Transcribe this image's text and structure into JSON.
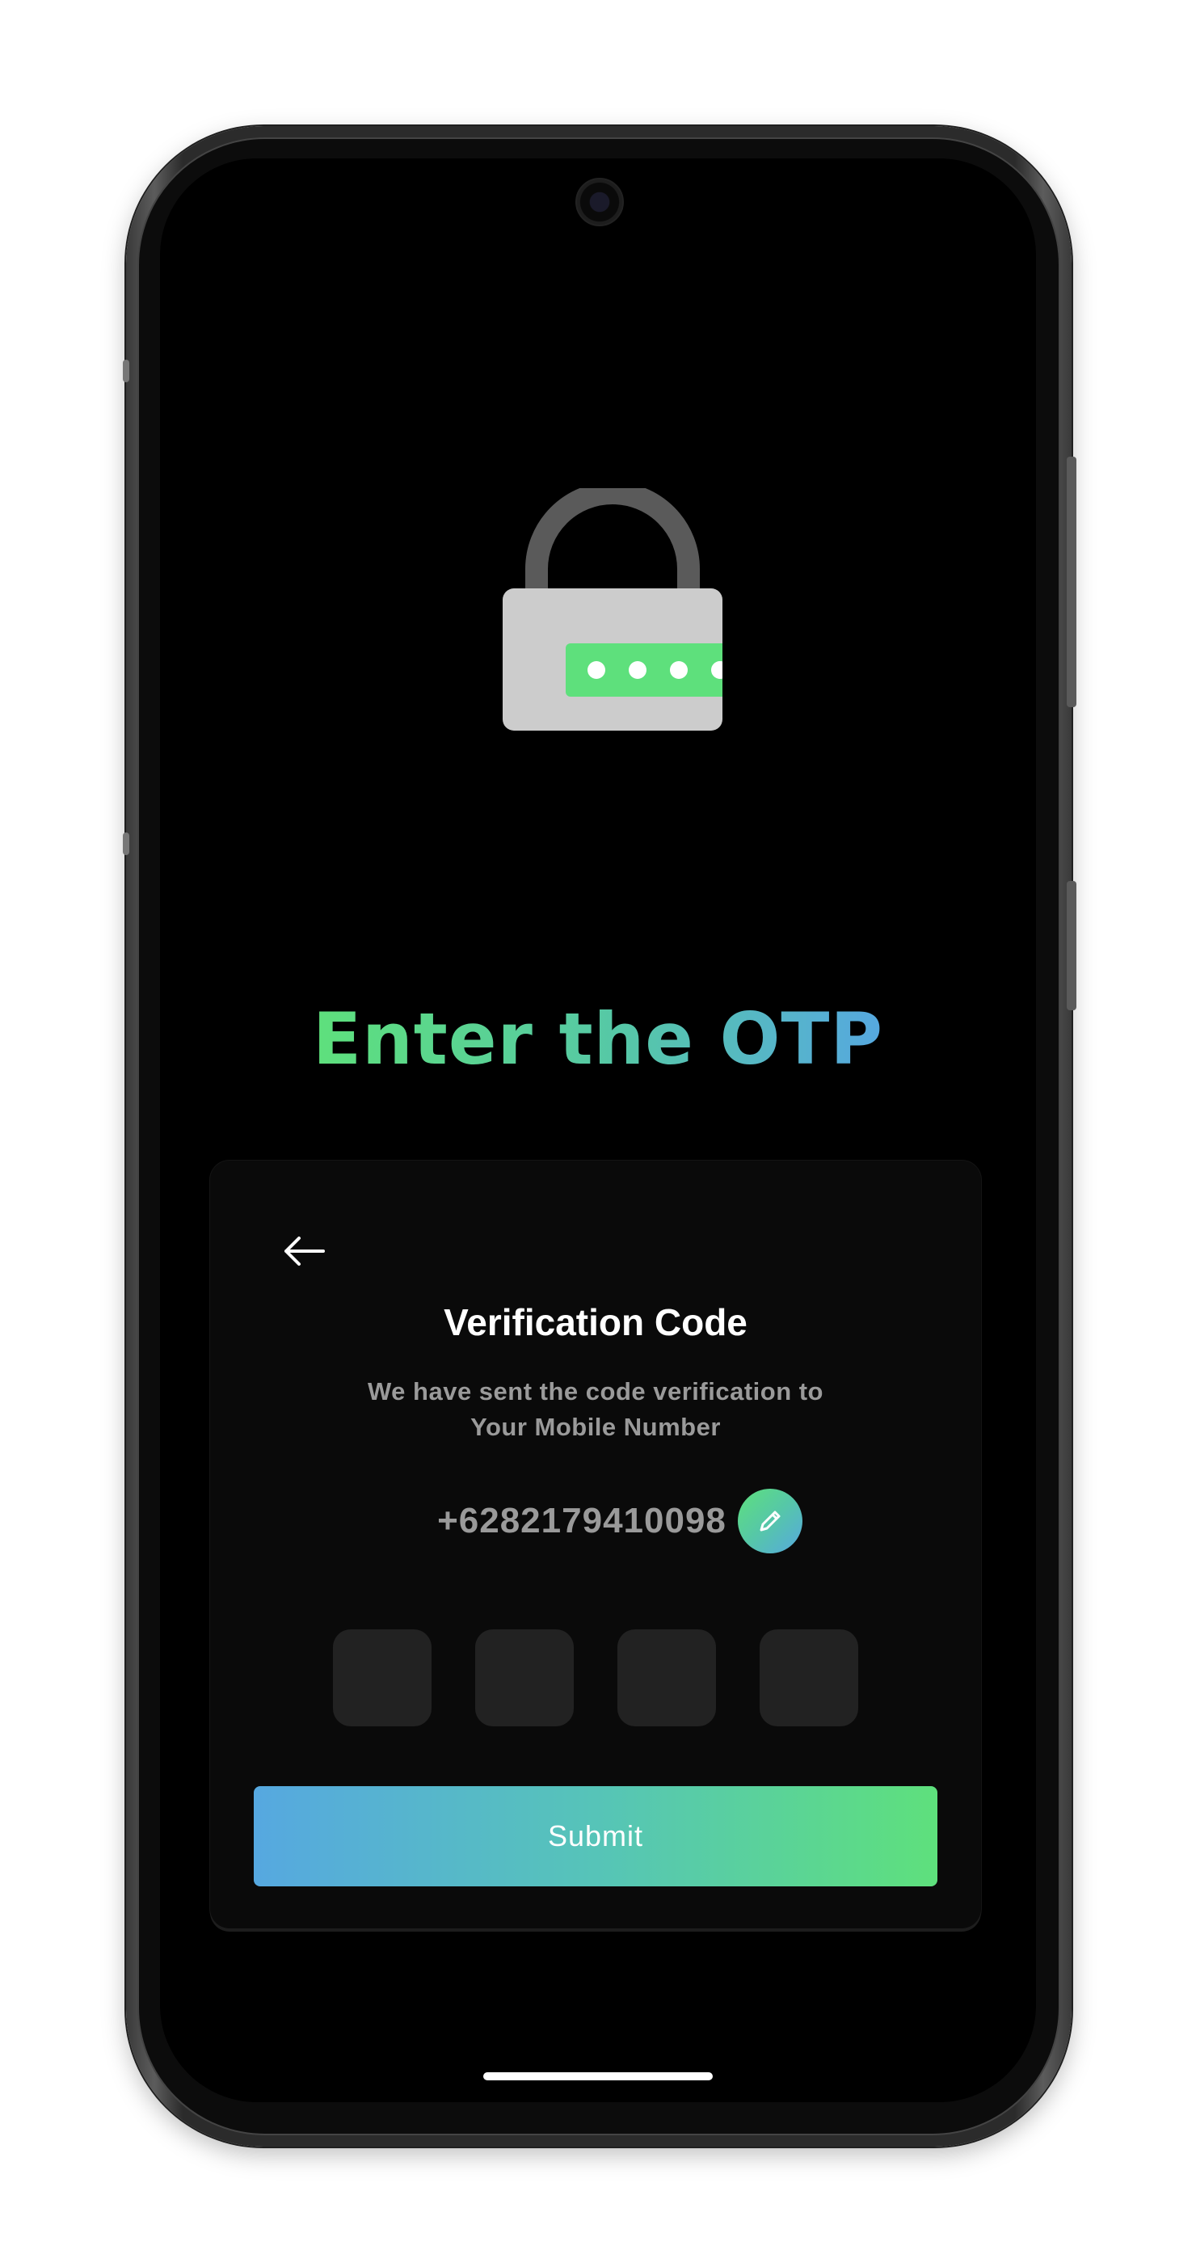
{
  "headline": {
    "text": "Enter the OTP"
  },
  "lock_illustration": {
    "icon": "padlock-password-icon",
    "password_dots": 4,
    "colors": {
      "shackle": "#5a5a5a",
      "body": "#cccccc",
      "field": "#5ee07c"
    }
  },
  "card": {
    "back_icon": "arrow-left-icon",
    "title": "Verification Code",
    "subtitle_line1": "We have sent the code verification to",
    "subtitle_line2": "Your Mobile Number",
    "phone_number": "+6282179410098",
    "edit_icon": "pencil-icon",
    "otp_digits": [
      "",
      "",
      "",
      ""
    ],
    "submit_label": "Submit"
  },
  "colors": {
    "gradient_green": "#5ee07c",
    "gradient_blue": "#56a8e0",
    "background": "#000000",
    "card": "#0a0a0a",
    "otp_box": "#222222",
    "muted_text": "#9a9a9a"
  }
}
